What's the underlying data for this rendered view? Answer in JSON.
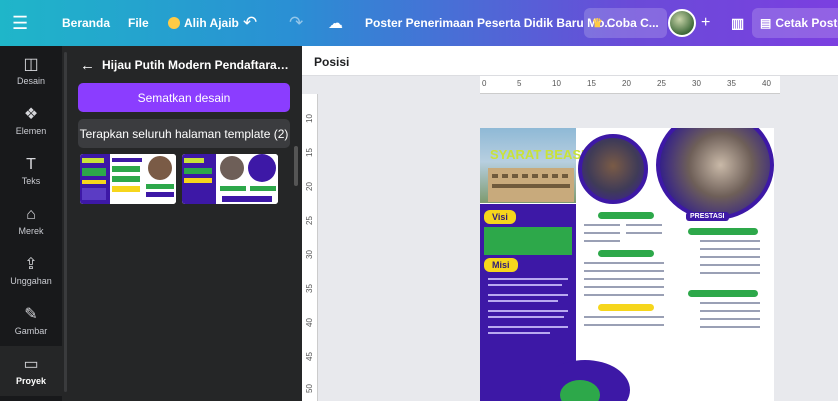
{
  "topbar": {
    "menu_icon": "menu-icon",
    "home": "Beranda",
    "file": "File",
    "resize": "Alih Ajaib",
    "doc_title": "Poster Penerimaan Peserta Didik Baru Mo...",
    "try": "Coba C...",
    "print": "Cetak Poste"
  },
  "rail": {
    "items": [
      {
        "label": "Desain",
        "icon": "layout-icon"
      },
      {
        "label": "Elemen",
        "icon": "shapes-icon"
      },
      {
        "label": "Teks",
        "icon": "text-icon"
      },
      {
        "label": "Merek",
        "icon": "brand-icon"
      },
      {
        "label": "Unggahan",
        "icon": "upload-icon"
      },
      {
        "label": "Gambar",
        "icon": "draw-icon"
      },
      {
        "label": "Proyek",
        "icon": "folder-icon"
      }
    ]
  },
  "panel": {
    "title": "Hijau Putih Modern Pendaftaran Siswa...",
    "pin_button": "Sematkan desain",
    "apply_button": "Terapkan seluruh halaman template (2)"
  },
  "canvas": {
    "position_label": "Posisi",
    "ruler_top": [
      "0",
      "5",
      "10",
      "15",
      "20",
      "25",
      "30",
      "35",
      "40"
    ],
    "ruler_left": [
      "10",
      "15",
      "20",
      "25",
      "30",
      "35",
      "40",
      "45",
      "50"
    ]
  },
  "poster": {
    "heading": "SYARAT BEASISWA",
    "visi": "Visi",
    "misi": "Misi",
    "prestasi": "PRESTASI"
  },
  "colors": {
    "accent": "#8b3dff",
    "poster_purple": "#3d18a6",
    "poster_yellow": "#f6d61c",
    "poster_green": "#2da84a"
  }
}
